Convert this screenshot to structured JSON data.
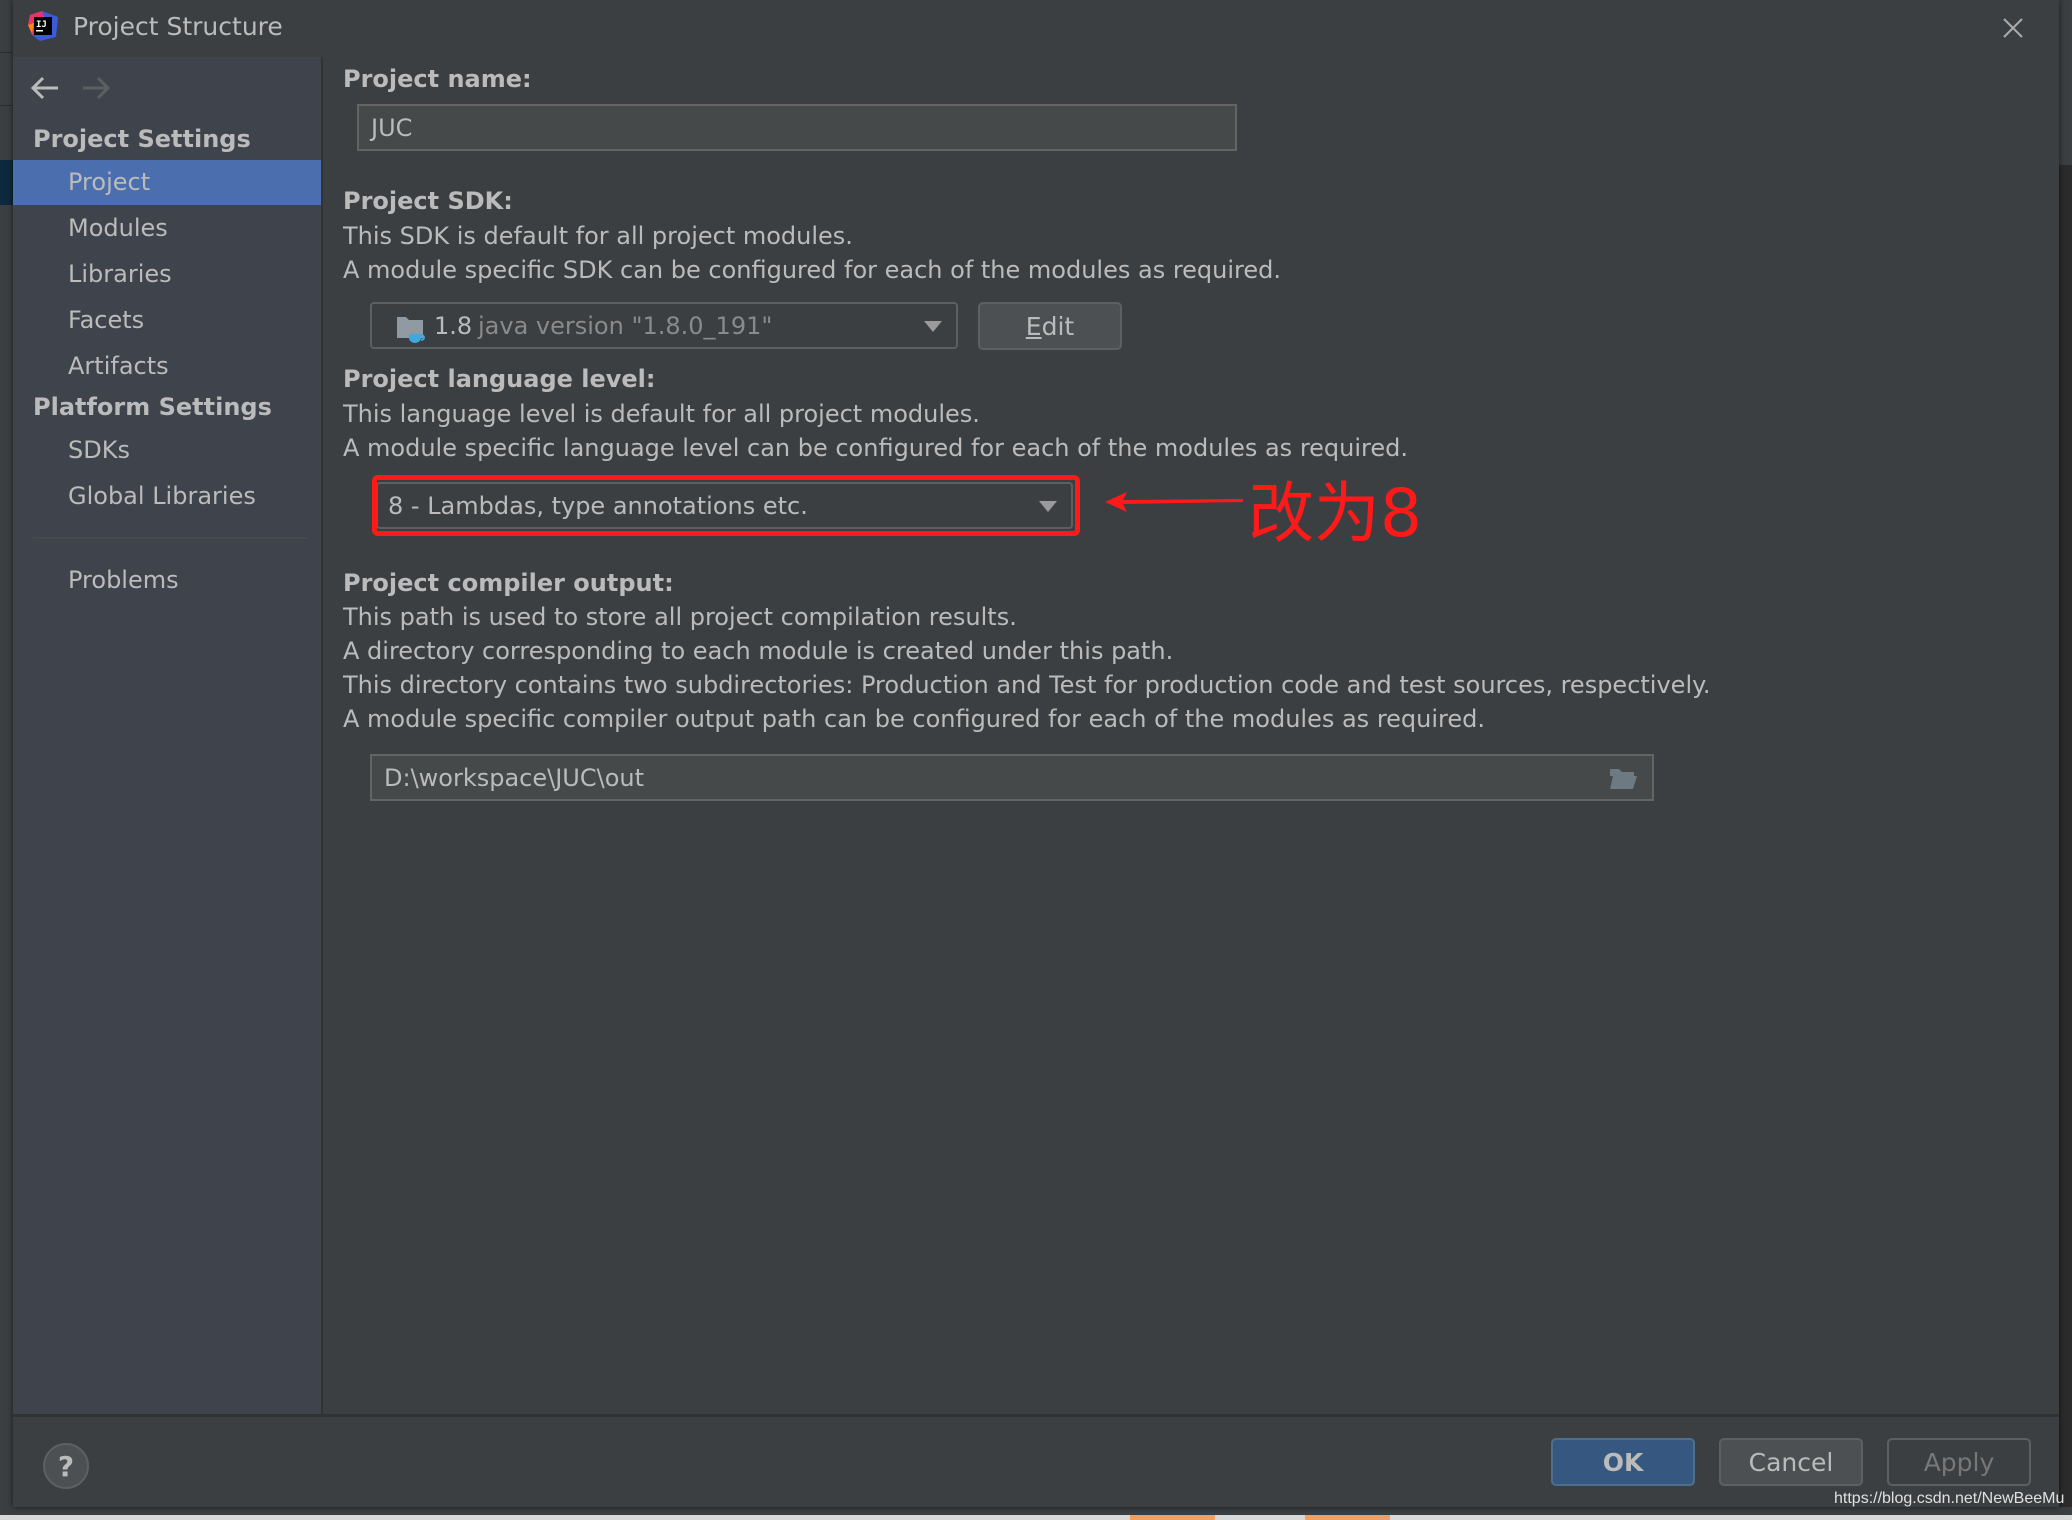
{
  "window": {
    "title": "Project Structure",
    "app_icon": "intellij-idea-icon",
    "close_icon": "close-icon"
  },
  "sidebar": {
    "nav_back_icon": "arrow-left-icon",
    "nav_forward_icon": "arrow-right-icon",
    "groups": [
      {
        "title": "Project Settings",
        "items": [
          {
            "label": "Project",
            "selected": true
          },
          {
            "label": "Modules",
            "selected": false
          },
          {
            "label": "Libraries",
            "selected": false
          },
          {
            "label": "Facets",
            "selected": false
          },
          {
            "label": "Artifacts",
            "selected": false
          }
        ]
      },
      {
        "title": "Platform Settings",
        "items": [
          {
            "label": "SDKs",
            "selected": false
          },
          {
            "label": "Global Libraries",
            "selected": false
          }
        ]
      }
    ],
    "problems_label": "Problems"
  },
  "main": {
    "project_name": {
      "label": "Project name:",
      "value": "JUC"
    },
    "project_sdk": {
      "label": "Project SDK:",
      "desc1": "This SDK is default for all project modules.",
      "desc2": "A module specific SDK can be configured for each of the modules as required.",
      "selected_version": "1.8",
      "selected_detail": "java version \"1.8.0_191\"",
      "edit_label": "Edit",
      "edit_mnemonic": "E",
      "edit_rest": "dit"
    },
    "language_level": {
      "label": "Project language level:",
      "desc1": "This language level is default for all project modules.",
      "desc2": "A module specific language level can be configured for each of the modules as required.",
      "selected": "8 - Lambdas, type annotations etc."
    },
    "compiler_output": {
      "label": "Project compiler output:",
      "desc1": "This path is used to store all project compilation results.",
      "desc2": "A directory corresponding to each module is created under this path.",
      "desc3": "This directory contains two subdirectories: Production and Test for production code and test sources, respectively.",
      "desc4": "A module specific compiler output path can be configured for each of the modules as required.",
      "path": "D:\\workspace\\JUC\\out"
    }
  },
  "annotation": {
    "text": "改为8",
    "color": "#ff1a1a"
  },
  "footer": {
    "help_label": "?",
    "ok_label": "OK",
    "cancel_label": "Cancel",
    "apply_label": "Apply"
  },
  "watermark": "https://blog.csdn.net/NewBeeMu",
  "colors": {
    "selection": "#4b6eaf",
    "ok_button": "#365880",
    "dialog_bg": "#3c3f41",
    "sidebar_bg": "#3e434c"
  }
}
